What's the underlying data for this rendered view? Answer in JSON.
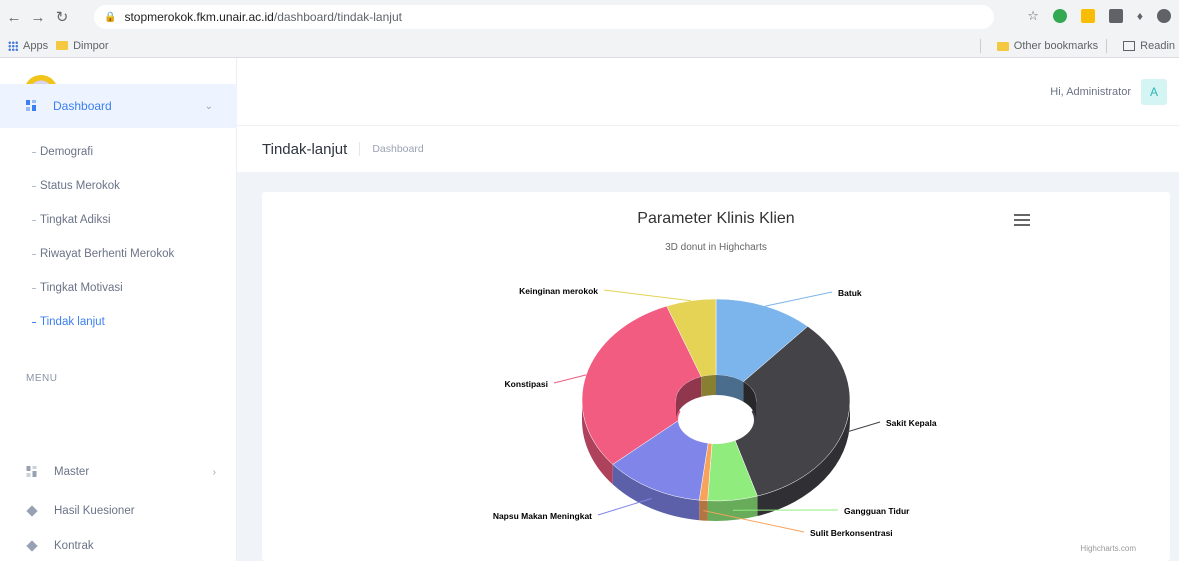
{
  "browser": {
    "url_host": "stopmerokok.fkm.unair.ac.id",
    "url_path": "/dashboard/tindak-lanjut",
    "bookmarks": [
      "Apps",
      "Dimpor"
    ],
    "bookmarks_right": [
      "Other bookmarks",
      "Readin"
    ]
  },
  "header": {
    "greeting": "Hi, Administrator",
    "avatar_initial": "A"
  },
  "page": {
    "title": "Tindak-lanjut",
    "breadcrumb": "Dashboard"
  },
  "sidebar": {
    "dashboard_label": "Dashboard",
    "sub_items": [
      {
        "label": "Demografi",
        "active": false
      },
      {
        "label": "Status Merokok",
        "active": false
      },
      {
        "label": "Tingkat Adiksi",
        "active": false
      },
      {
        "label": "Riwayat Berhenti Merokok",
        "active": false
      },
      {
        "label": "Tingkat Motivasi",
        "active": false
      },
      {
        "label": "Tindak lanjut",
        "active": true
      }
    ],
    "menu_heading": "MENU",
    "menu_items": [
      {
        "label": "Master"
      },
      {
        "label": "Hasil Kuesioner"
      },
      {
        "label": "Kontrak"
      }
    ]
  },
  "colors": {
    "accent": "#3b7ff0",
    "active_bg": "#eef4ff",
    "content_bg": "#f0f3f8"
  },
  "chart_data": {
    "type": "pie",
    "variant": "3D donut",
    "title": "Parameter Klinis Klien",
    "subtitle": "3D donut in Highcharts",
    "credits": "Highcharts.com",
    "slices": [
      {
        "name": "Batuk",
        "value": 12,
        "color": "#7cb5ec"
      },
      {
        "name": "Sakit Kepala",
        "value": 33,
        "color": "#434348"
      },
      {
        "name": "Gangguan Tidur",
        "value": 6,
        "color": "#90ed7d"
      },
      {
        "name": "Sulit Berkonsentrasi",
        "value": 1,
        "color": "#f7a35c"
      },
      {
        "name": "Napsu Makan Meningkat",
        "value": 12,
        "color": "#8085e9"
      },
      {
        "name": "Konstipasi",
        "value": 30,
        "color": "#f15c80"
      },
      {
        "name": "Keinginan merokok",
        "value": 6,
        "color": "#e4d354"
      }
    ]
  }
}
